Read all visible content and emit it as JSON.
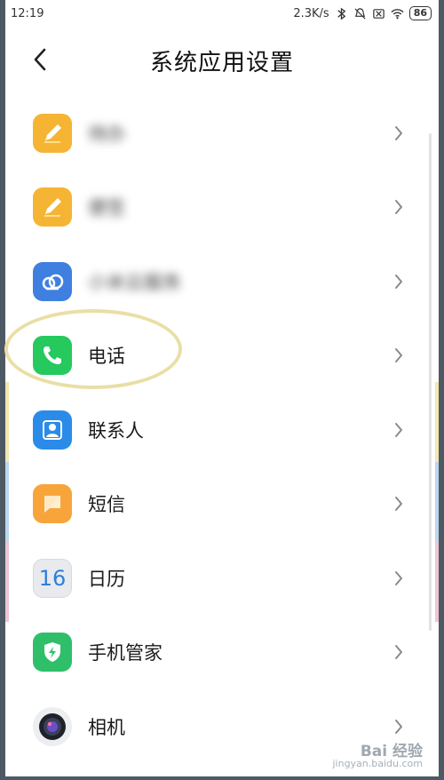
{
  "status_bar": {
    "time": "12:19",
    "network_speed": "2.3K/s",
    "battery": "86"
  },
  "header": {
    "title": "系统应用设置"
  },
  "list": {
    "items": [
      {
        "label": "待办",
        "icon": "notes-icon",
        "blurred": true
      },
      {
        "label": "便签",
        "icon": "notes-icon",
        "blurred": true
      },
      {
        "label": "小米云服务",
        "icon": "cloud-icon",
        "blurred": true
      },
      {
        "label": "电话",
        "icon": "phone-icon",
        "blurred": false
      },
      {
        "label": "联系人",
        "icon": "contacts-icon",
        "blurred": false
      },
      {
        "label": "短信",
        "icon": "message-icon",
        "blurred": false
      },
      {
        "label": "日历",
        "icon": "calendar-icon",
        "icon_text": "16",
        "blurred": false
      },
      {
        "label": "手机管家",
        "icon": "security-icon",
        "blurred": false
      },
      {
        "label": "相机",
        "icon": "camera-icon",
        "blurred": false
      }
    ]
  },
  "watermark": {
    "brand": "Bai 经验",
    "url": "jingyan.baidu.com"
  },
  "colors": {
    "notes": "#f5b433",
    "cloud": "#3f7fe0",
    "phone": "#25c95d",
    "contacts": "#2b8be8",
    "message": "#f7a53b",
    "calendar": "#e8eaed",
    "security": "#2fbf6a",
    "highlight": "#e9dfa5"
  }
}
